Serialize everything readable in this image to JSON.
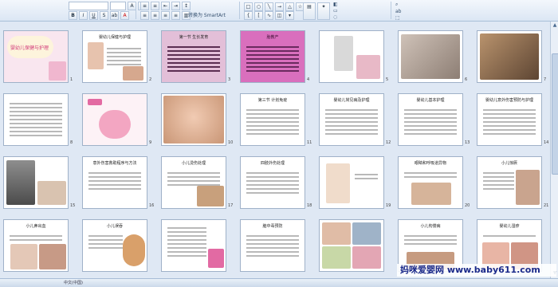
{
  "ribbon": {
    "font_name": "",
    "font_size": "",
    "convert_label": "转换为 SmartArt",
    "text_direction": "",
    "find_label": "",
    "replace_label": "",
    "select_label": ""
  },
  "slides": [
    {
      "n": "1",
      "title": "婴幼儿保健与护理"
    },
    {
      "n": "2",
      "title": "婴幼儿保健与护理"
    },
    {
      "n": "3",
      "title": "第一节 生长发育"
    },
    {
      "n": "4",
      "title": "胎教产"
    },
    {
      "n": "5",
      "title": ""
    },
    {
      "n": "6",
      "title": ""
    },
    {
      "n": "7",
      "title": ""
    },
    {
      "n": "8",
      "title": ""
    },
    {
      "n": "9",
      "title": ""
    },
    {
      "n": "10",
      "title": ""
    },
    {
      "n": "11",
      "title": "第三节 计划免疫"
    },
    {
      "n": "12",
      "title": "婴幼儿常见病及护理"
    },
    {
      "n": "13",
      "title": "婴幼儿基本护理"
    },
    {
      "n": "14",
      "title": "婴幼儿意外伤害预防与护理"
    },
    {
      "n": "15",
      "title": ""
    },
    {
      "n": "16",
      "title": "意外伤害救助程序与方法"
    },
    {
      "n": "17",
      "title": "小儿烫伤处理"
    },
    {
      "n": "18",
      "title": "四肢外伤处理"
    },
    {
      "n": "19",
      "title": ""
    },
    {
      "n": "20",
      "title": "眼睛和呼吸道异物"
    },
    {
      "n": "21",
      "title": "小儿惊厥"
    },
    {
      "n": "22",
      "title": "小儿鼻出血"
    },
    {
      "n": "23",
      "title": "小儿误吞"
    },
    {
      "n": "24",
      "title": ""
    },
    {
      "n": "25",
      "title": "脑中毒预防"
    },
    {
      "n": "26",
      "title": ""
    },
    {
      "n": "27",
      "title": "小儿佝偻病"
    },
    {
      "n": "28",
      "title": "婴幼儿湿疹"
    }
  ],
  "status": {
    "slide_info": "",
    "theme": "",
    "language": "中文(中国)"
  },
  "watermark": "妈咪爱婴网 www.baby611.com",
  "colors": {
    "ribbon_bg": "#dbe6f4",
    "sorter_bg": "#dfe8f4",
    "status_bg": "#cbd9ea"
  }
}
